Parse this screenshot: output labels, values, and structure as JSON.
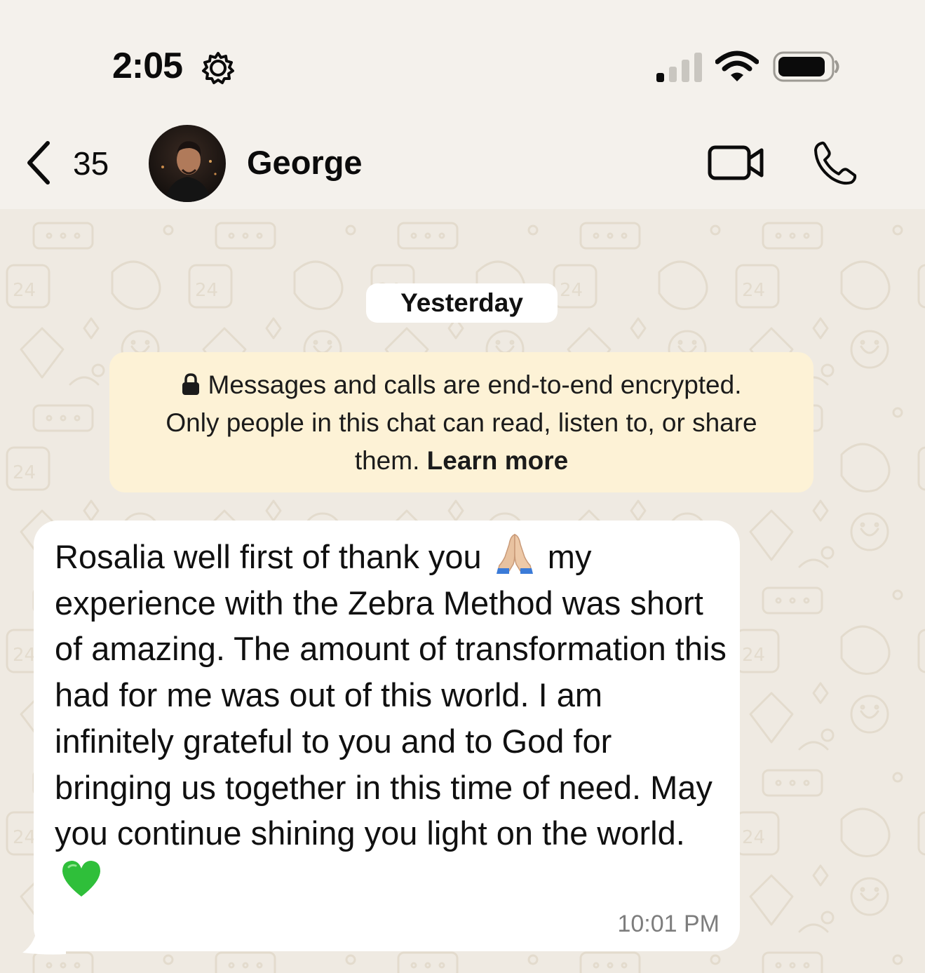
{
  "status_bar": {
    "time": "2:05"
  },
  "header": {
    "back_count": "35",
    "contact_name": "George"
  },
  "chat": {
    "date_label": "Yesterday",
    "encryption_notice": {
      "line1": "Messages and calls are end-to-end encrypted.",
      "line2": "Only people in this chat can read, listen to, or share",
      "line3": "them.",
      "link": "Learn more"
    },
    "message": {
      "text_part1": "Rosalia well first of thank you",
      "text_part2": "my experience with the Zebra Method was short of amazing. The amount of transformation this had for me was out of this world. I am infinitely grateful to you and to God for bringing us together in this time of need. May you continue shining you light on the world.",
      "time": "10:01 PM"
    }
  },
  "colors": {
    "chat_background": "#efeae2",
    "notice_background": "#fdf2d6",
    "bubble_background": "#ffffff",
    "heart": "#2fbf3a"
  },
  "icons": [
    "gear-icon",
    "signal-icon",
    "wifi-icon",
    "battery-icon",
    "back-chevron-icon",
    "video-call-icon",
    "phone-call-icon",
    "lock-icon",
    "folded-hands-emoji",
    "green-heart-emoji"
  ]
}
